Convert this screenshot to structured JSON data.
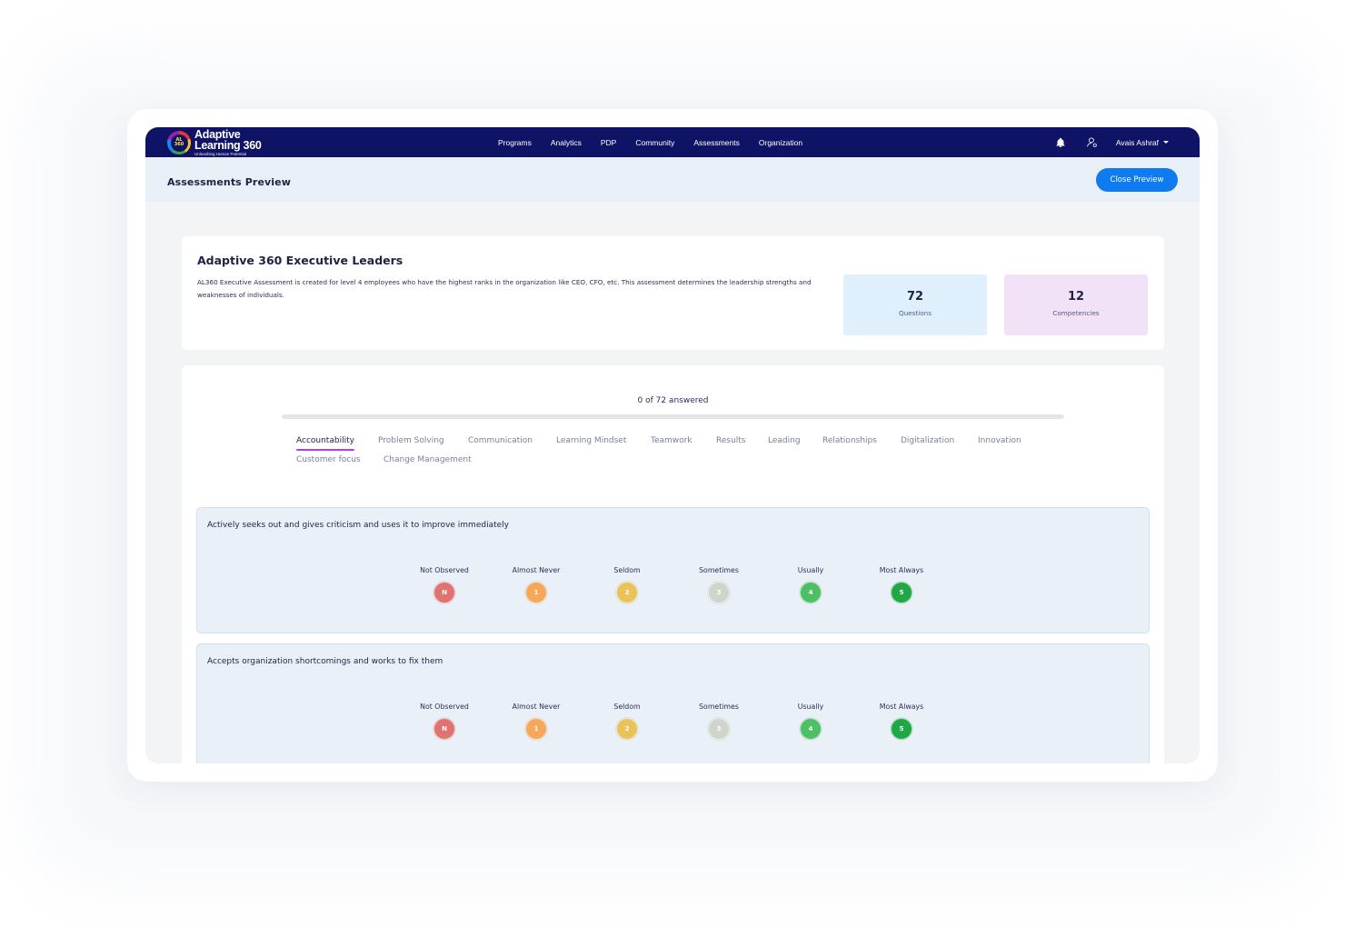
{
  "colors": {
    "navbar": "#0f1366",
    "accent": "#0f7bf0",
    "tab_underline": "#b23cf0",
    "scale": [
      "#e07272",
      "#f5a75a",
      "#e9c25a",
      "#cfd5c8",
      "#4dbf65",
      "#1fa845"
    ]
  },
  "navbar": {
    "logo": {
      "line1": "Adaptive",
      "line2": "Learning 360",
      "tagline": "Unleashing Human Potential",
      "mark": "AL 360"
    },
    "links": [
      "Programs",
      "Analytics",
      "PDP",
      "Community",
      "Assessments",
      "Organization"
    ],
    "icons": [
      "bell-icon",
      "user-icon"
    ],
    "user": "Avais Ashraf"
  },
  "header": {
    "title": "Assessments Preview",
    "close_label": "Close Preview"
  },
  "assessment": {
    "title": "Adaptive 360 Executive Leaders",
    "description": "AL360 Executive Assessment is created for level 4 employees who have the highest ranks in the organization like CEO, CFO, etc. This assessment determines the leadership strengths and weaknesses of individuals.",
    "stats": {
      "questions": {
        "value": "72",
        "label": "Questions"
      },
      "competencies": {
        "value": "12",
        "label": "Competencies"
      }
    }
  },
  "progress": {
    "text": "0 of 72 answered",
    "fraction": 0
  },
  "tabs": [
    "Accountability",
    "Problem Solving",
    "Communication",
    "Learning Mindset",
    "Teamwork",
    "Results",
    "Leading",
    "Relationships",
    "Digitalization",
    "Innovation",
    "Customer focus",
    "Change Management"
  ],
  "active_tab": 0,
  "scale": [
    {
      "label": "Not Observed",
      "value": "N"
    },
    {
      "label": "Almost Never",
      "value": "1"
    },
    {
      "label": "Seldom",
      "value": "2"
    },
    {
      "label": "Sometimes",
      "value": "3"
    },
    {
      "label": "Usually",
      "value": "4"
    },
    {
      "label": "Most Always",
      "value": "5"
    }
  ],
  "questions": [
    {
      "text": "Actively seeks out and gives criticism and uses it to improve immediately"
    },
    {
      "text": "Accepts organization shortcomings and works to fix them"
    }
  ]
}
